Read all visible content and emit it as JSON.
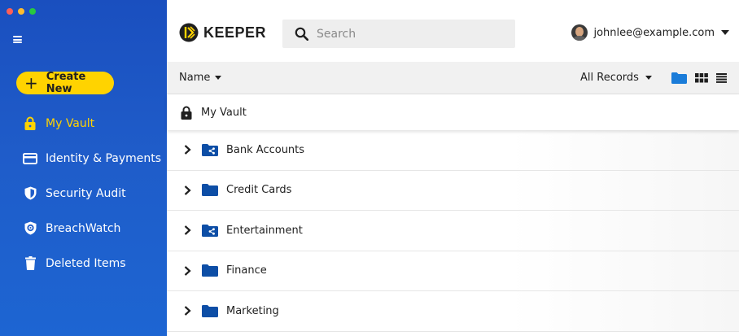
{
  "sidebar": {
    "create_label": "Create New",
    "items": [
      {
        "label": "My Vault",
        "icon": "lock-icon",
        "active": true
      },
      {
        "label": "Identity & Payments",
        "icon": "card-icon",
        "active": false
      },
      {
        "label": "Security Audit",
        "icon": "shield-icon",
        "active": false
      },
      {
        "label": "BreachWatch",
        "icon": "breachwatch-icon",
        "active": false
      },
      {
        "label": "Deleted Items",
        "icon": "trash-icon",
        "active": false
      }
    ]
  },
  "header": {
    "logo_text": "KEEPER",
    "search_placeholder": "Search",
    "user_email": "johnlee@example.com"
  },
  "toolbar": {
    "sort_label": "Name",
    "filter_label": "All Records"
  },
  "vault": {
    "label": "My Vault"
  },
  "folders": [
    {
      "name": "Bank Accounts",
      "shared": true
    },
    {
      "name": "Credit Cards",
      "shared": false
    },
    {
      "name": "Entertainment",
      "shared": true
    },
    {
      "name": "Finance",
      "shared": false
    },
    {
      "name": "Marketing",
      "shared": false
    }
  ],
  "colors": {
    "sidebar": "#1f5cc9",
    "accent": "#ffd300",
    "folder": "#0d4ea6"
  }
}
